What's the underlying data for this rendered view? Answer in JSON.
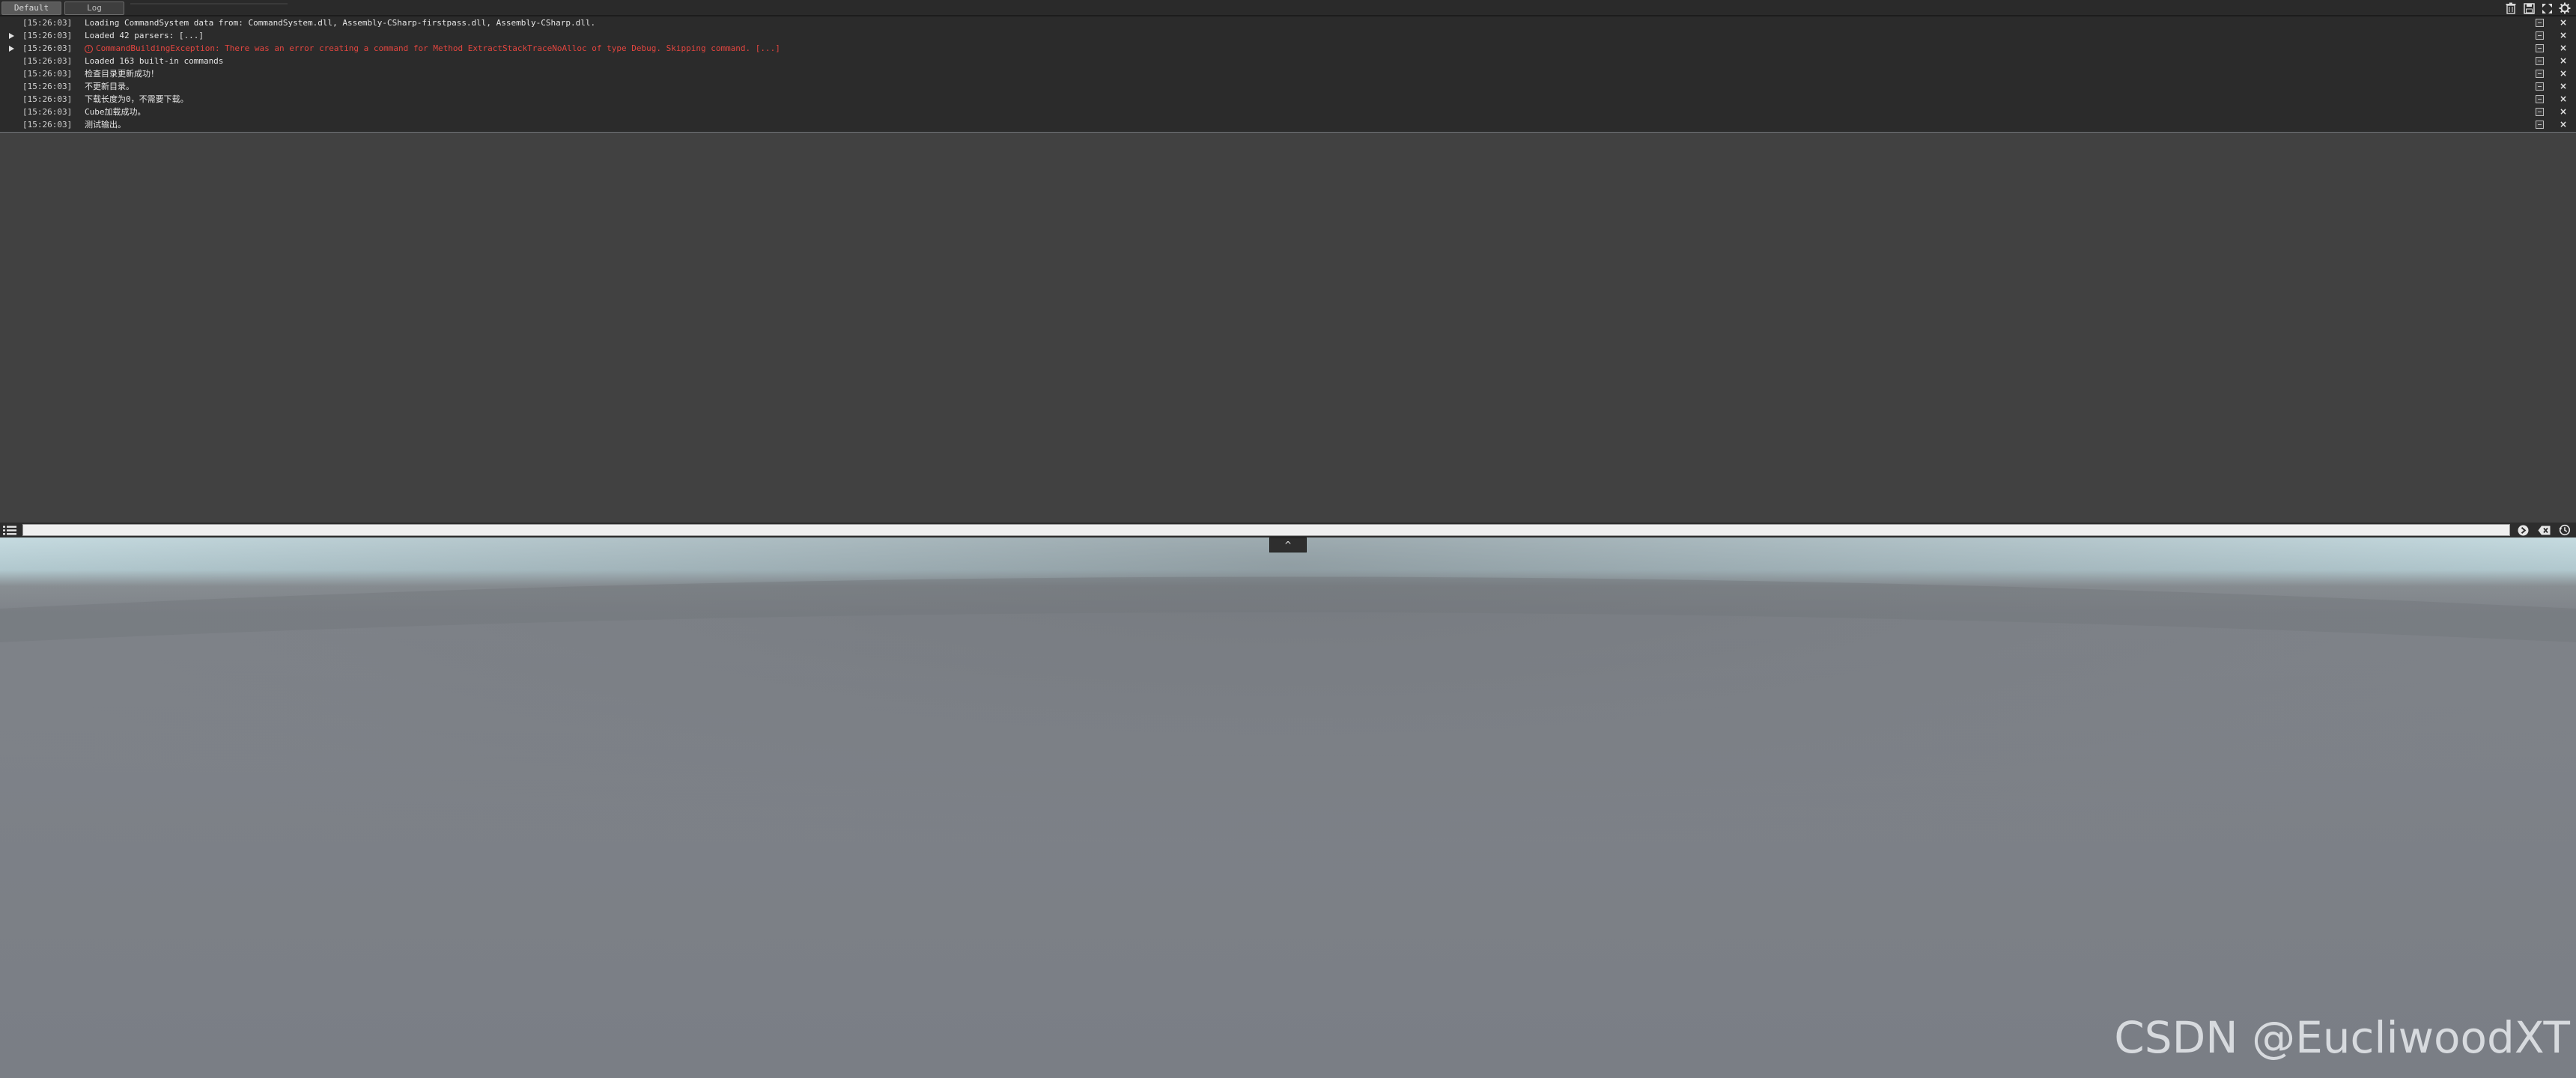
{
  "tabs": [
    {
      "label": "Default",
      "active": true
    },
    {
      "label": "Log",
      "active": false
    }
  ],
  "toolbar": {
    "icons": [
      "trash-icon",
      "save-icon",
      "expand-icon",
      "settings-icon"
    ]
  },
  "log": {
    "rows": [
      {
        "timestamp": "[15:26:03]",
        "message": "Loading CommandSystem data from: CommandSystem.dll, Assembly-CSharp-firstpass.dll, Assembly-CSharp.dll.",
        "type": "info",
        "expandable": false
      },
      {
        "timestamp": "[15:26:03]",
        "message": "Loaded 42 parsers: [...]",
        "type": "info",
        "expandable": true
      },
      {
        "timestamp": "[15:26:03]",
        "message": "CommandBuildingException: There was an error creating a command for Method ExtractStackTraceNoAlloc of type Debug. Skipping command. [...]",
        "type": "error",
        "expandable": true
      },
      {
        "timestamp": "[15:26:03]",
        "message": "Loaded 163 built-in commands",
        "type": "info",
        "expandable": false
      },
      {
        "timestamp": "[15:26:03]",
        "message": "检查目录更新成功！",
        "type": "info",
        "expandable": false
      },
      {
        "timestamp": "[15:26:03]",
        "message": "不更新目录。",
        "type": "info",
        "expandable": false
      },
      {
        "timestamp": "[15:26:03]",
        "message": "下载长度为0，不需要下载。",
        "type": "info",
        "expandable": false
      },
      {
        "timestamp": "[15:26:03]",
        "message": "Cube加载成功。",
        "type": "info",
        "expandable": false
      },
      {
        "timestamp": "[15:26:03]",
        "message": "测试输出。",
        "type": "info",
        "expandable": false
      }
    ]
  },
  "command": {
    "value": "",
    "placeholder": ""
  },
  "collapse": {
    "label": "^"
  },
  "watermark": "CSDN @EucliwoodXT",
  "colors": {
    "error": "#e2453f",
    "log_bg": "#2b2b2b",
    "console_bg": "#414141",
    "sky_top": "#c7e0e6",
    "ground": "#7b7f86"
  }
}
